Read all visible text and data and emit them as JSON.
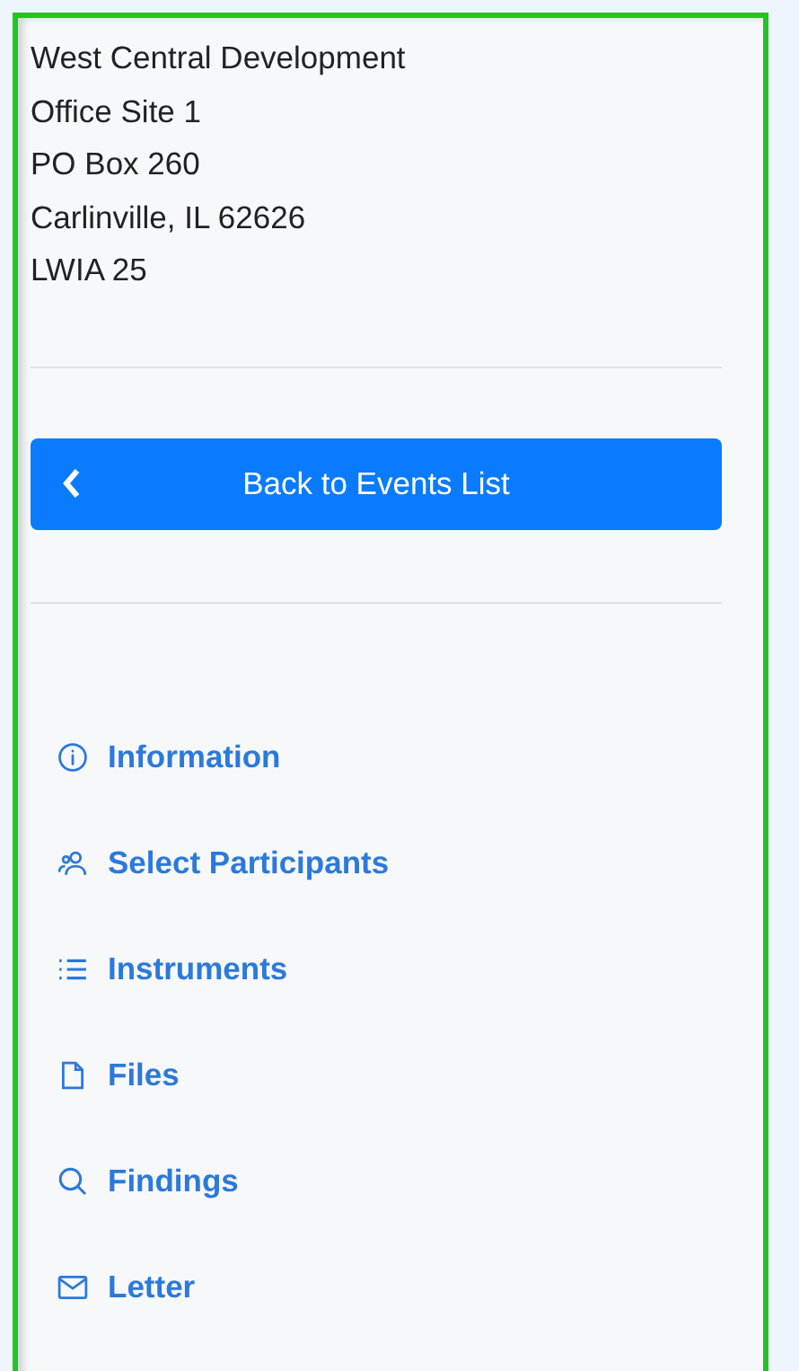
{
  "address": [
    "West Central Development",
    "Office Site 1",
    "PO Box 260",
    "Carlinville, IL 62626",
    "LWIA 25"
  ],
  "back_button": {
    "label": "Back to Events List"
  },
  "nav": [
    {
      "kind": "info",
      "label": "Information"
    },
    {
      "kind": "people",
      "label": "Select Participants"
    },
    {
      "kind": "list",
      "label": "Instruments"
    },
    {
      "kind": "file",
      "label": "Files"
    },
    {
      "kind": "search",
      "label": "Findings"
    },
    {
      "kind": "mail",
      "label": "Letter"
    }
  ]
}
